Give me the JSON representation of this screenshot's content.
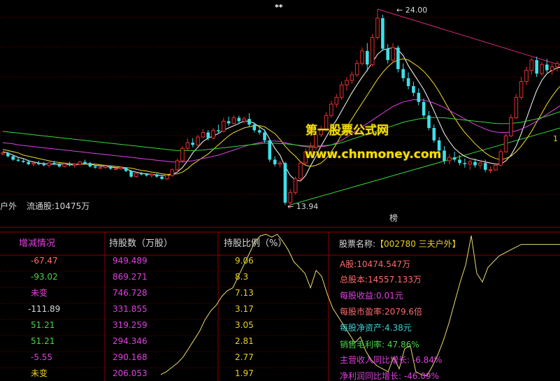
{
  "colors": {
    "background": "#000000",
    "grid": "#8a0000",
    "candle_up": "#e83030",
    "candle_down": "#40e0e8",
    "ma_short": "#ffffff",
    "ma_mid": "#f2dd28",
    "ma_long1": "#e040e0",
    "ma_long2": "#38d838",
    "trendline_upper": "#d8287a",
    "trendline_lower": "#38d838",
    "panel_line": "#e8dc70",
    "text_red": "#ff6a6a",
    "text_green": "#4ad44a",
    "text_magenta": "#e040e0",
    "text_yellow": "#e8d020",
    "text_light": "#d8d8d8"
  },
  "top_marker": "**",
  "chart": {
    "high_label": "24.00",
    "low_label": "13.94",
    "stock_caption": "户外",
    "float_shares": "流通股:10475万",
    "bottom_marker": "榜",
    "right_marker": "1"
  },
  "watermark": {
    "line1": "第一股票公式网",
    "line2": "www.chnmoney.com"
  },
  "table": {
    "headers": [
      "增减情况",
      "持股数（万股）",
      "持股比例（%）"
    ],
    "rows": [
      {
        "change": "-67.47",
        "shares": "949.489",
        "ratio": "9.06"
      },
      {
        "change": "-93.02",
        "shares": "869.271",
        "ratio": "8.3"
      },
      {
        "change": "未变",
        "shares": "746.728",
        "ratio": "7.13"
      },
      {
        "change": "-111.89",
        "shares": "331.855",
        "ratio": "3.17"
      },
      {
        "change": "51.21",
        "shares": "319.259",
        "ratio": "3.05"
      },
      {
        "change": "51.21",
        "shares": "294.346",
        "ratio": "2.81"
      },
      {
        "change": "-5.55",
        "shares": "290.168",
        "ratio": "2.77"
      },
      {
        "change": "未变",
        "shares": "206.053",
        "ratio": "1.97"
      }
    ]
  },
  "info": {
    "name_prefix": "股票名称:",
    "name": "【002780 三夫户外】",
    "a_shares": "A股:10474.547万",
    "total_shares": "总股本:14557.133万",
    "eps": "每股收益:0.01元",
    "pe": "每股市盈率:2079.6倍",
    "nav": "每股净资产:4.38元",
    "gross_margin": "销售毛利率: 47.86%",
    "revenue_growth": "主营收入同比增长: -6.84%",
    "profit_growth": "净利润同比增长: -46.09%"
  },
  "chart_data": {
    "type": "candlestick",
    "candles": [
      [
        11.2,
        11.4,
        11.1,
        11.3
      ],
      [
        11.3,
        11.4,
        10.9,
        11.0
      ],
      [
        11.0,
        11.1,
        10.6,
        10.7
      ],
      [
        10.7,
        10.9,
        10.5,
        10.6
      ],
      [
        10.6,
        10.8,
        10.4,
        10.5
      ],
      [
        10.5,
        10.7,
        10.2,
        10.3
      ],
      [
        10.3,
        10.5,
        10.1,
        10.4
      ],
      [
        10.4,
        10.6,
        10.2,
        10.3
      ],
      [
        10.3,
        10.5,
        10.1,
        10.2
      ],
      [
        10.2,
        10.5,
        10.0,
        10.4
      ],
      [
        10.4,
        10.6,
        10.2,
        10.3
      ],
      [
        10.3,
        10.4,
        10.0,
        10.1
      ],
      [
        10.1,
        10.4,
        10.0,
        10.3
      ],
      [
        10.3,
        10.5,
        10.1,
        10.2
      ],
      [
        10.2,
        10.4,
        10.0,
        10.3
      ],
      [
        10.3,
        10.6,
        10.2,
        10.5
      ],
      [
        10.5,
        10.7,
        10.3,
        10.4
      ],
      [
        10.4,
        10.5,
        10.0,
        10.1
      ],
      [
        10.1,
        10.2,
        9.9,
        10.0
      ],
      [
        10.0,
        10.1,
        9.9,
        10.0
      ],
      [
        10.0,
        10.2,
        9.9,
        10.1
      ],
      [
        10.1,
        10.2,
        9.8,
        9.9
      ],
      [
        9.9,
        10.0,
        9.8,
        9.9
      ],
      [
        9.9,
        10.1,
        9.8,
        10.0
      ],
      [
        10.0,
        10.0,
        9.6,
        9.7
      ],
      [
        9.7,
        9.8,
        9.1,
        9.2
      ],
      [
        9.2,
        9.6,
        9.1,
        9.5
      ],
      [
        9.5,
        9.6,
        9.3,
        9.4
      ],
      [
        9.4,
        9.5,
        9.2,
        9.3
      ],
      [
        9.3,
        9.5,
        9.1,
        9.4
      ],
      [
        9.4,
        9.5,
        9.1,
        9.2
      ],
      [
        9.2,
        9.3,
        8.9,
        9.0
      ],
      [
        9.0,
        9.4,
        8.9,
        9.3
      ],
      [
        9.3,
        9.9,
        9.2,
        9.8
      ],
      [
        9.8,
        10.8,
        9.7,
        10.6
      ],
      [
        10.6,
        11.9,
        10.5,
        11.7
      ],
      [
        11.7,
        12.6,
        11.5,
        12.2
      ],
      [
        12.2,
        12.6,
        11.8,
        12.0
      ],
      [
        12.0,
        12.9,
        11.9,
        12.7
      ],
      [
        12.7,
        13.4,
        12.6,
        13.1
      ],
      [
        13.1,
        13.3,
        12.4,
        12.6
      ],
      [
        12.6,
        13.5,
        12.5,
        13.3
      ],
      [
        13.3,
        13.8,
        13.0,
        13.2
      ],
      [
        13.2,
        14.4,
        13.1,
        14.1
      ],
      [
        14.1,
        14.5,
        13.7,
        13.9
      ],
      [
        13.9,
        14.6,
        13.8,
        14.4
      ],
      [
        14.4,
        14.6,
        13.9,
        14.1
      ],
      [
        14.1,
        14.5,
        13.9,
        14.3
      ],
      [
        14.3,
        14.8,
        13.6,
        13.8
      ],
      [
        13.8,
        14.0,
        13.1,
        13.3
      ],
      [
        13.3,
        13.6,
        12.9,
        13.1
      ],
      [
        13.1,
        13.4,
        12.2,
        12.4
      ],
      [
        12.4,
        12.5,
        10.5,
        10.7
      ],
      [
        10.7,
        11.0,
        10.1,
        10.3
      ],
      [
        10.3,
        10.6,
        10.0,
        10.4
      ],
      [
        10.4,
        10.5,
        6.7,
        6.9
      ],
      [
        6.9,
        8.1,
        6.4,
        7.8
      ],
      [
        7.8,
        9.2,
        7.6,
        9.0
      ],
      [
        9.0,
        10.6,
        8.8,
        10.4
      ],
      [
        10.4,
        11.7,
        10.2,
        11.4
      ],
      [
        11.4,
        12.2,
        11.0,
        11.8
      ],
      [
        11.8,
        13.2,
        11.6,
        12.9
      ],
      [
        12.9,
        13.7,
        12.7,
        13.4
      ],
      [
        13.4,
        14.9,
        13.2,
        14.6
      ],
      [
        14.6,
        15.9,
        14.4,
        15.6
      ],
      [
        15.6,
        16.5,
        15.3,
        16.2
      ],
      [
        16.2,
        17.6,
        16.0,
        17.3
      ],
      [
        17.3,
        18.0,
        16.8,
        17.7
      ],
      [
        17.7,
        18.5,
        17.4,
        18.2
      ],
      [
        18.2,
        19.5,
        18.0,
        19.2
      ],
      [
        19.2,
        20.6,
        19.0,
        20.3
      ],
      [
        20.3,
        21.0,
        18.5,
        19.1
      ],
      [
        19.1,
        21.8,
        18.9,
        21.5
      ],
      [
        21.5,
        24.0,
        21.3,
        23.2
      ],
      [
        23.2,
        23.5,
        20.3,
        20.5
      ],
      [
        20.5,
        20.9,
        19.2,
        19.5
      ],
      [
        19.5,
        21.0,
        19.3,
        20.6
      ],
      [
        20.6,
        20.8,
        18.4,
        18.7
      ],
      [
        18.7,
        19.2,
        17.6,
        17.9
      ],
      [
        17.9,
        18.4,
        16.9,
        17.2
      ],
      [
        17.2,
        17.6,
        16.3,
        16.6
      ],
      [
        16.6,
        17.0,
        15.5,
        15.8
      ],
      [
        15.8,
        16.1,
        14.4,
        14.6
      ],
      [
        14.6,
        15.0,
        13.3,
        13.5
      ],
      [
        13.5,
        13.8,
        12.2,
        12.4
      ],
      [
        12.4,
        12.7,
        11.2,
        11.5
      ],
      [
        11.5,
        11.9,
        10.3,
        10.6
      ],
      [
        10.6,
        11.2,
        10.3,
        10.9
      ],
      [
        10.9,
        11.4,
        10.5,
        10.7
      ],
      [
        10.7,
        11.1,
        10.2,
        10.4
      ],
      [
        10.4,
        10.8,
        10.0,
        10.3
      ],
      [
        10.3,
        10.7,
        9.8,
        10.5
      ],
      [
        10.5,
        10.8,
        10.0,
        10.2
      ],
      [
        10.2,
        10.6,
        9.9,
        10.4
      ],
      [
        10.4,
        10.7,
        9.6,
        9.8
      ],
      [
        9.8,
        10.1,
        9.5,
        9.8
      ],
      [
        9.8,
        10.4,
        9.7,
        10.2
      ],
      [
        10.2,
        11.6,
        10.1,
        11.4
      ],
      [
        11.4,
        13.0,
        11.3,
        12.8
      ],
      [
        12.8,
        14.7,
        12.7,
        14.4
      ],
      [
        14.4,
        16.5,
        14.3,
        16.2
      ],
      [
        16.2,
        18.0,
        16.0,
        17.6
      ],
      [
        17.6,
        18.9,
        17.3,
        18.6
      ],
      [
        18.6,
        19.7,
        18.2,
        19.5
      ],
      [
        19.5,
        19.8,
        18.0,
        18.3
      ],
      [
        18.3,
        19.3,
        18.1,
        19.1
      ],
      [
        19.1,
        19.6,
        18.4,
        18.6
      ],
      [
        18.6,
        19.2,
        18.2,
        18.9
      ],
      [
        18.9,
        19.4,
        18.5,
        19.2
      ]
    ],
    "ma": [
      {
        "period": 5,
        "values": [
          11.4,
          11.3,
          11.1,
          10.9,
          10.8,
          10.6,
          10.5,
          10.4,
          10.35,
          10.3,
          10.3,
          10.3,
          10.3,
          10.25,
          10.25,
          10.3,
          10.35,
          10.3,
          10.2,
          10.15,
          10.1,
          10.05,
          10.0,
          9.95,
          9.9,
          9.7,
          9.6,
          9.5,
          9.45,
          9.4,
          9.35,
          9.3,
          9.3,
          9.4,
          9.6,
          10.0,
          10.6,
          11.3,
          11.8,
          12.3,
          12.6,
          12.8,
          13.0,
          13.3,
          13.5,
          13.7,
          13.9,
          14.1,
          14.1,
          13.9,
          13.6,
          13.3,
          12.5,
          11.7,
          11.1,
          10.1,
          9.3,
          8.9,
          8.8,
          9.3,
          10.2,
          11.0,
          11.9,
          12.7,
          13.5,
          14.2,
          15.0,
          15.8,
          16.6,
          17.3,
          18.0,
          18.6,
          19.3,
          20.0,
          20.4,
          20.5,
          20.6,
          20.4,
          19.9,
          19.0,
          18.3,
          17.6,
          16.9,
          16.0,
          15.0,
          14.0,
          13.0,
          12.3,
          11.7,
          11.3,
          11.0,
          10.8,
          10.7,
          10.6,
          10.5,
          10.4,
          10.3,
          10.3,
          10.6,
          11.1,
          11.9,
          13.0,
          14.3,
          15.6,
          16.8,
          17.7,
          18.3,
          18.6,
          18.8,
          18.9,
          19.0,
          19.0
        ]
      },
      {
        "period": 10,
        "values": [
          11.6,
          11.5,
          11.4,
          11.3,
          11.1,
          11.0,
          10.9,
          10.8,
          10.7,
          10.6,
          10.5,
          10.45,
          10.4,
          10.35,
          10.3,
          10.3,
          10.3,
          10.3,
          10.3,
          10.25,
          10.2,
          10.15,
          10.1,
          10.05,
          10.0,
          9.95,
          9.85,
          9.75,
          9.7,
          9.6,
          9.55,
          9.45,
          9.4,
          9.4,
          9.45,
          9.6,
          9.9,
          10.3,
          10.6,
          10.9,
          11.2,
          11.6,
          12.0,
          12.4,
          12.8,
          13.1,
          13.3,
          13.5,
          13.6,
          13.7,
          13.7,
          13.6,
          13.3,
          13.0,
          12.5,
          11.9,
          11.4,
          11.0,
          10.5,
          10.2,
          10.1,
          10.2,
          10.4,
          10.8,
          11.4,
          12.1,
          12.9,
          13.6,
          14.3,
          15.0,
          15.7,
          16.4,
          17.1,
          17.8,
          18.4,
          18.9,
          19.3,
          19.5,
          19.6,
          19.5,
          19.2,
          18.9,
          18.5,
          18.0,
          17.4,
          16.7,
          15.9,
          15.1,
          14.4,
          13.7,
          13.1,
          12.6,
          12.1,
          11.7,
          11.3,
          11.0,
          10.8,
          10.7,
          10.8,
          11.0,
          11.4,
          11.9,
          12.5,
          13.2,
          14.0,
          14.8,
          15.6,
          16.3,
          16.9,
          17.4,
          17.8,
          18.1
        ]
      },
      {
        "period": 20,
        "values": [
          12.2,
          12.15,
          12.1,
          12.0,
          11.95,
          11.9,
          11.85,
          11.8,
          11.75,
          11.7,
          11.65,
          11.6,
          11.55,
          11.5,
          11.45,
          11.4,
          11.35,
          11.3,
          11.25,
          11.2,
          11.15,
          11.1,
          11.05,
          11.0,
          10.95,
          10.9,
          10.85,
          10.8,
          10.75,
          10.7,
          10.65,
          10.6,
          10.55,
          10.5,
          10.5,
          10.5,
          10.55,
          10.6,
          10.7,
          10.8,
          10.9,
          11.0,
          11.1,
          11.25,
          11.4,
          11.55,
          11.7,
          11.85,
          12.0,
          12.1,
          12.2,
          12.3,
          12.35,
          12.35,
          12.3,
          12.2,
          12.1,
          12.0,
          11.9,
          11.85,
          11.8,
          11.8,
          11.85,
          11.9,
          12.0,
          12.2,
          12.4,
          12.7,
          13.0,
          13.3,
          13.6,
          13.9,
          14.2,
          14.5,
          14.8,
          15.1,
          15.4,
          15.6,
          15.8,
          15.9,
          16.0,
          16.0,
          15.95,
          15.85,
          15.7,
          15.5,
          15.3,
          15.05,
          14.8,
          14.55,
          14.3,
          14.05,
          13.8,
          13.6,
          13.4,
          13.25,
          13.15,
          13.1,
          13.1,
          13.15,
          13.25,
          13.4,
          13.6,
          13.85,
          14.1,
          14.4,
          14.7,
          15.0,
          15.3,
          15.6,
          15.9,
          16.2
        ]
      },
      {
        "period": 30,
        "values": [
          13.2,
          13.15,
          13.1,
          13.05,
          13.0,
          12.95,
          12.9,
          12.85,
          12.8,
          12.75,
          12.7,
          12.65,
          12.6,
          12.55,
          12.5,
          12.45,
          12.4,
          12.35,
          12.3,
          12.25,
          12.2,
          12.15,
          12.1,
          12.05,
          12.0,
          11.95,
          11.9,
          11.85,
          11.8,
          11.75,
          11.7,
          11.65,
          11.6,
          11.55,
          11.5,
          11.5,
          11.5,
          11.5,
          11.52,
          11.55,
          11.6,
          11.65,
          11.7,
          11.75,
          11.8,
          11.85,
          11.9,
          11.95,
          12.0,
          12.05,
          12.1,
          12.15,
          12.15,
          12.15,
          12.12,
          12.1,
          12.05,
          12.0,
          11.95,
          11.9,
          11.9,
          11.9,
          11.92,
          11.95,
          12.0,
          12.1,
          12.2,
          12.35,
          12.5,
          12.65,
          12.8,
          12.95,
          13.1,
          13.25,
          13.4,
          13.55,
          13.7,
          13.85,
          14.0,
          14.1,
          14.2,
          14.3,
          14.35,
          14.4,
          14.42,
          14.42,
          14.4,
          14.35,
          14.3,
          14.25,
          14.2,
          14.15,
          14.1,
          14.05,
          14.0,
          13.95,
          13.9,
          13.88,
          13.88,
          13.9,
          13.95,
          14.0,
          14.1,
          14.2,
          14.3,
          14.42,
          14.55,
          14.7,
          14.85,
          15.0,
          15.15,
          15.3
        ]
      }
    ],
    "annotations": [
      {
        "text": "24.00"
      },
      {
        "text": "13.94"
      }
    ],
    "holder_line": [
      0,
      0,
      0,
      0,
      0,
      0,
      0,
      0,
      0,
      0,
      0,
      0,
      0,
      0,
      0,
      0,
      0,
      0,
      0,
      0,
      0,
      0,
      0,
      0,
      0,
      0,
      0,
      0,
      0,
      0,
      0,
      0,
      0,
      0,
      0,
      0,
      0,
      0,
      0,
      0,
      0,
      0,
      0,
      0,
      0,
      0,
      0,
      0,
      0,
      0,
      0,
      0,
      0,
      0,
      0,
      0,
      0,
      0,
      0,
      0,
      0,
      0,
      0,
      0,
      0,
      0,
      0,
      0,
      0,
      0,
      0,
      0,
      0,
      0,
      0,
      0,
      0,
      0,
      0,
      0,
      0,
      0,
      0,
      0,
      0,
      0,
      0,
      0,
      0,
      0,
      0,
      0,
      0,
      0,
      0,
      0,
      0,
      0,
      0,
      0,
      0,
      0,
      0,
      0,
      0,
      0,
      0,
      0,
      0,
      0
    ],
    "panel_series": {
      "name": "",
      "values": [
        0.02,
        0.04,
        0.07,
        0.1,
        0.14,
        0.2,
        0.26,
        0.32,
        0.4,
        0.46,
        0.5,
        0.56,
        0.6,
        0.62,
        0.7,
        0.78,
        0.86,
        0.94,
        0.98,
        0.99,
        0.97,
        0.99,
        0.94,
        0.88,
        0.8,
        0.76,
        0.72,
        0.62,
        0.74,
        0.7,
        0.58,
        0.48,
        0.42,
        0.36,
        0.3,
        0.24,
        0.28,
        0.18,
        0.12,
        0.08,
        0.06,
        0.04,
        0.14,
        0.06,
        0.2,
        0.22,
        0.04,
        0.02,
        0.01,
        0.08,
        0.16,
        0.26,
        0.38,
        0.52,
        0.66,
        0.78,
        0.98,
        0.72,
        0.66,
        0.76,
        0.8,
        0.84,
        0.86,
        0.88,
        0.9,
        0.92,
        0.92,
        0.92,
        0.92,
        0.92,
        0.92,
        0.92,
        0.92
      ]
    }
  }
}
